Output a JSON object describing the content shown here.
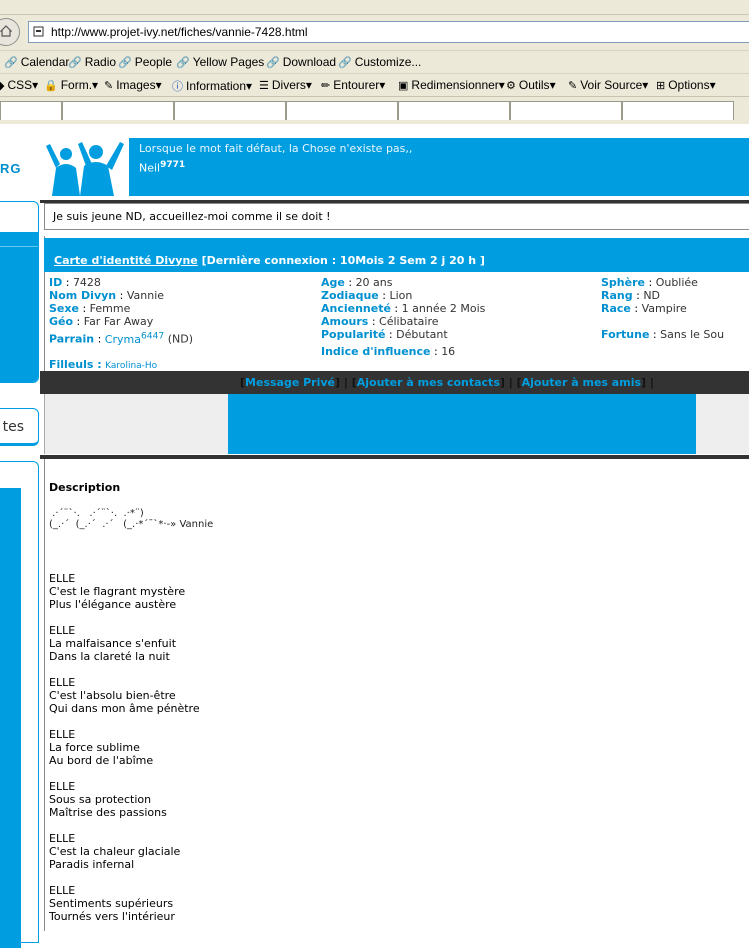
{
  "browser": {
    "url": "http://www.projet-ivy.net/fiches/vannie-7428.html",
    "bookmarks": [
      "Calendar",
      "Radio",
      "People",
      "Yellow Pages",
      "Download",
      "Customize..."
    ],
    "webdev_toolbar": [
      "CSS",
      "Form.",
      "Images",
      "Information",
      "Divers",
      "Entourer",
      "Redimensionner",
      "Outils",
      "Voir Source",
      "Options"
    ]
  },
  "colors": {
    "brand_blue": "#009ee0",
    "dark_bar": "#333333"
  },
  "left_menu": {
    "partial_label": "tes",
    "logo_partial": "RG"
  },
  "header": {
    "slogan": "Lorsque le mot fait défaut, la Chose n'existe pas,,",
    "username": "Neil",
    "user_number": "9771"
  },
  "welcome": "Je suis jeune ND, accueillez-moi comme il se doit !",
  "card": {
    "title_link": "Carte d'identité Divyne",
    "last_connection": " [Dernière connexion : 10Mois 2 Sem 2 j 20 h ]",
    "col1": {
      "id_label": "ID",
      "id_value": "7428",
      "nom_label": "Nom Divyn",
      "nom_value": "Vannie",
      "sexe_label": "Sexe",
      "sexe_value": "Femme",
      "geo_label": "Géo",
      "geo_value": "Far Far Away",
      "parrain_label": "Parrain",
      "parrain_name": "Cryma",
      "parrain_num": "6447",
      "parrain_rank": " (ND)",
      "filleuls_label": "Filleuls :",
      "filleuls_value": "Karolina-Ho"
    },
    "col2": {
      "age_label": "Age",
      "age_value": "20 ans",
      "zodiaque_label": "Zodiaque",
      "zodiaque_value": "Lion",
      "anciennete_label": "Ancienneté",
      "anciennete_value": "1 année 2 Mois",
      "amours_label": "Amours",
      "amours_value": "Célibataire",
      "popularite_label": "Popularité",
      "popularite_value": "Débutant",
      "influence_label": "Indice d'influence",
      "influence_value": "16"
    },
    "col3": {
      "sphere_label": "Sphère",
      "sphere_value": "Oubliée",
      "rang_label": "Rang",
      "rang_value": "ND",
      "race_label": "Race",
      "race_value": "Vampire",
      "fortune_label": "Fortune",
      "fortune_value": "Sans le Sou"
    }
  },
  "actions": {
    "message": "Message Privé",
    "contacts": "Ajouter à mes contacts",
    "amis": "Ajouter à mes amis"
  },
  "description": {
    "title": "Description",
    "signature_line1": " .·´¨`·.   .·´¨`·.  .·*¨)",
    "signature_line2": "(_.·´  (_.·´  .·´   (_.·*´¯`*·-» Vannie",
    "stanzas": [
      "ELLE\nC'est le flagrant mystère\nPlus l'élégance austère",
      "ELLE\nLa malfaisance s'enfuit\nDans la clareté la nuit",
      "ELLE\nC'est l'absolu bien-être\nQui dans mon âme pénètre",
      "ELLE\nLa force sublime\nAu bord de l'abîme",
      "ELLE\nSous sa protection\nMaîtrise des passions",
      "ELLE\nC'est la chaleur glaciale\nParadis infernal",
      "ELLE\nSentiments supérieurs\nTournés vers l'intérieur"
    ]
  }
}
